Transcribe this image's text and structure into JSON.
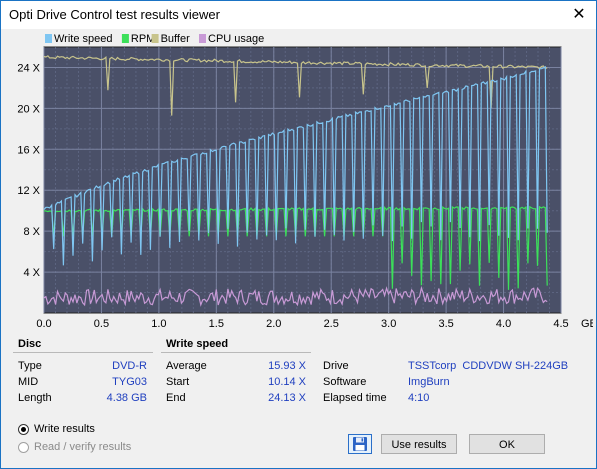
{
  "window": {
    "title": "Opti Drive Control test results viewer",
    "close_glyph": "✕"
  },
  "chart_data": {
    "type": "line",
    "legend": [
      {
        "name": "Write speed",
        "color": "#7fc6f2"
      },
      {
        "name": "RPM",
        "color": "#3ce05a"
      },
      {
        "name": "Buffer",
        "color": "#c8c48c"
      },
      {
        "name": "CPU usage",
        "color": "#c89ad6"
      }
    ],
    "xlabel": "",
    "ylabel": "",
    "x_unit_label": "GB",
    "xlim": [
      0,
      4.5
    ],
    "ylim": [
      0,
      26
    ],
    "x_ticks": [
      "0.0",
      "0.5",
      "1.0",
      "1.5",
      "2.0",
      "2.5",
      "3.0",
      "3.5",
      "4.0",
      "4.5"
    ],
    "y_ticks": [
      "4 X",
      "8 X",
      "12 X",
      "16 X",
      "20 X",
      "24 X"
    ],
    "y_tick_values": [
      4,
      8,
      12,
      16,
      20,
      24
    ],
    "grid": true,
    "background": "#4a5068",
    "series": [
      {
        "name": "Write speed",
        "x": [
          0.0,
          0.5,
          1.0,
          1.5,
          2.0,
          2.5,
          3.0,
          3.5,
          4.0,
          4.38
        ],
        "values": [
          10.14,
          12.5,
          14.4,
          16.0,
          17.5,
          18.9,
          20.3,
          21.6,
          22.9,
          24.13
        ]
      },
      {
        "name": "RPM",
        "x": [
          0.0,
          4.38
        ],
        "values": [
          10.0,
          10.3
        ]
      },
      {
        "name": "Buffer",
        "x": [
          0.0,
          4.38
        ],
        "values": [
          25.0,
          24.0
        ]
      },
      {
        "name": "CPU usage",
        "x": [
          0.0,
          4.38
        ],
        "values": [
          1.5,
          1.7
        ]
      }
    ]
  },
  "disc": {
    "header": "Disc",
    "type_label": "Type",
    "type_value": "DVD-R",
    "mid_label": "MID",
    "mid_value": "TYG03",
    "length_label": "Length",
    "length_value": "4.38 GB"
  },
  "write_speed": {
    "header": "Write speed",
    "average_label": "Average",
    "average_value": "15.93 X",
    "start_label": "Start",
    "start_value": "10.14 X",
    "end_label": "End",
    "end_value": "24.13 X"
  },
  "drive_info": {
    "drive_label": "Drive",
    "drive_value": "TSSTcorp  CDDVDW SH-224GB",
    "software_label": "Software",
    "software_value": "ImgBurn",
    "elapsed_label": "Elapsed time",
    "elapsed_value": "4:10"
  },
  "options": {
    "write_results": "Write results",
    "read_verify": "Read / verify results"
  },
  "buttons": {
    "use_results": "Use results",
    "ok": "OK"
  },
  "colors": {
    "accent": "#1a73c4",
    "value_text": "#1f3fbf"
  }
}
